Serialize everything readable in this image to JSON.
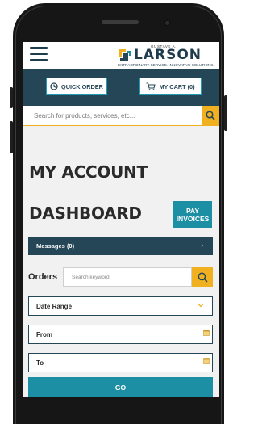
{
  "header": {
    "logo_small": "GUSTAVE A.",
    "logo_name": "LARSON",
    "logo_tagline": "EXTRAORDINARY SERVICE. INNOVATIVE SOLUTIONS."
  },
  "nav": {
    "quick_order": "QUICK ORDER",
    "my_cart": "MY CART (0)"
  },
  "search": {
    "placeholder": "Search for products, services, etc..."
  },
  "page": {
    "title_line1": "MY ACCOUNT",
    "title_line2": "DASHBOARD",
    "pay_invoices_line1": "PAY",
    "pay_invoices_line2": "INVOICES"
  },
  "messages": {
    "label": "Messages (0)",
    "chevron": "›"
  },
  "orders": {
    "label": "Orders",
    "search_placeholder": "Search keyword"
  },
  "filters": {
    "date_range": "Date Range",
    "from": "From",
    "to": "To",
    "go": "GO"
  },
  "colors": {
    "navy": "#244656",
    "teal": "#1d8fa5",
    "accent_yellow": "#f0b020"
  }
}
